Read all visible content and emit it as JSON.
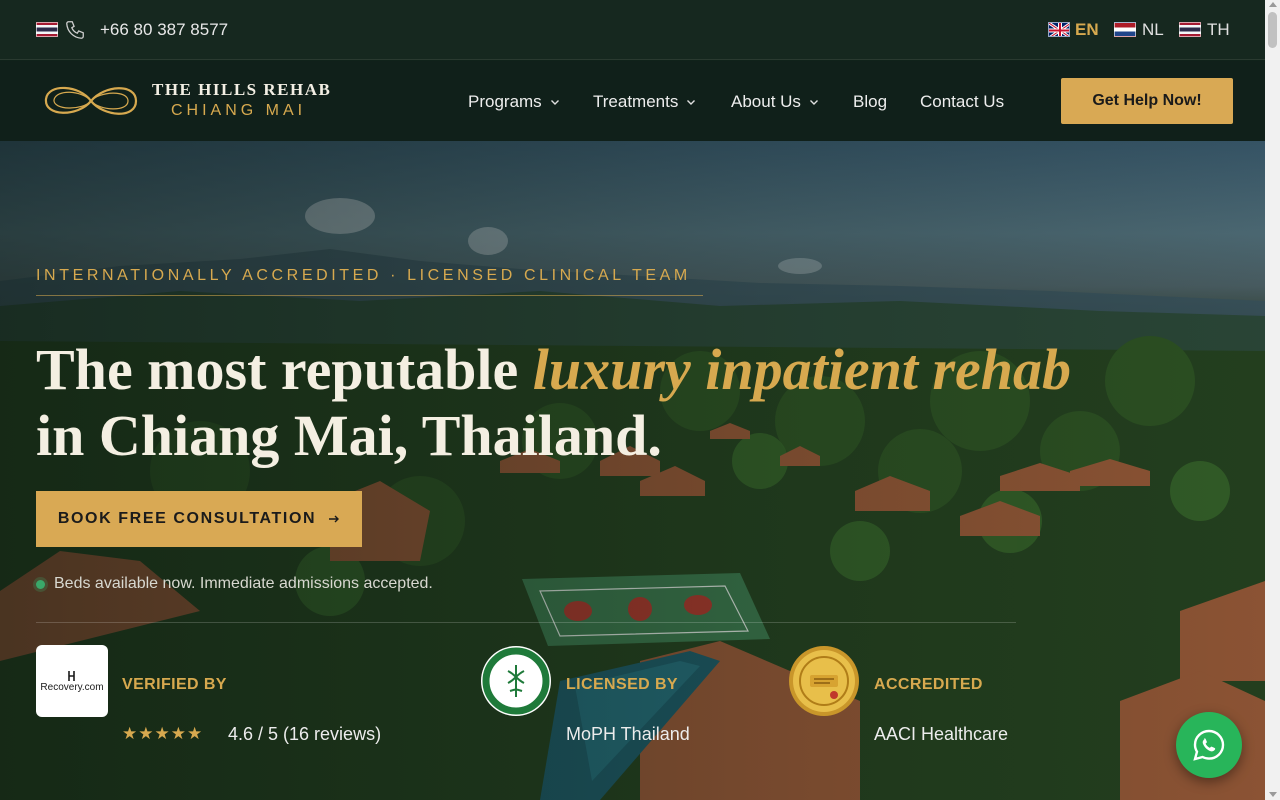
{
  "topbar": {
    "phone": "+66 80 387 8577",
    "languages": [
      {
        "code": "EN",
        "active": true
      },
      {
        "code": "NL",
        "active": false
      },
      {
        "code": "TH",
        "active": false
      }
    ]
  },
  "nav": {
    "logo_line1": "THE HILLS REHAB",
    "logo_line2": "CHIANG MAI",
    "menu": [
      {
        "label": "Programs",
        "dropdown": true
      },
      {
        "label": "Treatments",
        "dropdown": true
      },
      {
        "label": "About Us",
        "dropdown": true
      },
      {
        "label": "Blog",
        "dropdown": false
      },
      {
        "label": "Contact Us",
        "dropdown": false
      }
    ],
    "cta": "Get Help Now!"
  },
  "hero": {
    "eyebrow": "INTERNATIONALLY ACCREDITED · LICENSED CLINICAL TEAM",
    "headline_part1": "The most reputable ",
    "headline_accent": "luxury inpatient rehab",
    "headline_part2": "in Chiang Mai, Thailand.",
    "book_button": "BOOK FREE CONSULTATION",
    "availability": "Beds available now. Immediate admissions accepted."
  },
  "badges": {
    "recovery_logo_text": "Recovery.com",
    "verified_label": "VERIFIED BY",
    "rating_stars": "★★★★★",
    "rating_text": "4.6 / 5 (16 reviews)",
    "licensed_label": "LICENSED BY",
    "licensed_value": "MoPH Thailand",
    "accredited_label": "ACCREDITED",
    "accredited_value": "AACI Healthcare"
  },
  "colors": {
    "gold": "#d7a94f",
    "dark_green": "#10201a",
    "whatsapp": "#28b55a"
  },
  "icons": {
    "phone": "phone-icon",
    "chevron": "chevron-down-icon",
    "arrow": "arrow-right-icon",
    "whatsapp": "whatsapp-icon"
  }
}
